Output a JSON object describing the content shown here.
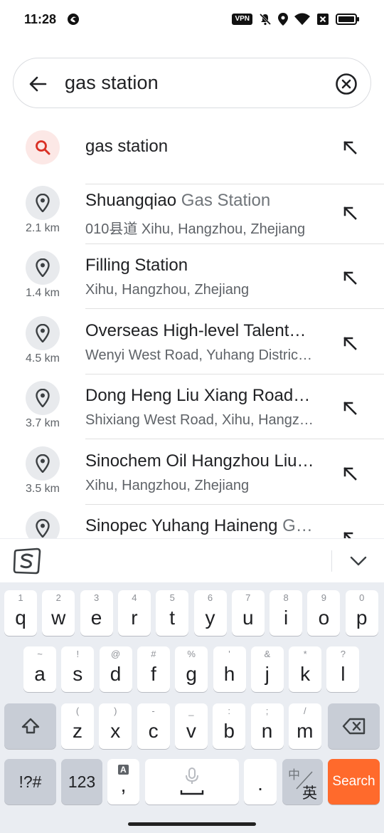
{
  "status_bar": {
    "time": "11:28",
    "vpn_label": "VPN",
    "icons": [
      "vpn-icon",
      "mute-icon",
      "location-icon",
      "wifi-icon",
      "no-sim-icon",
      "battery-icon"
    ]
  },
  "search": {
    "query": "gas station",
    "back_icon": "arrow-left-icon",
    "clear_icon": "clear-circle-icon"
  },
  "results": [
    {
      "type": "query",
      "title": "gas station",
      "title_muted": "",
      "subtitle": "",
      "distance": ""
    },
    {
      "type": "place",
      "title": "Shuangqiao ",
      "title_muted": "Gas Station",
      "subtitle": "010县道 Xihu, Hangzhou, Zhejiang",
      "distance": "2.1 km"
    },
    {
      "type": "place",
      "title": "Filling Station",
      "title_muted": "",
      "subtitle": "Xihu, Hangzhou, Zhejiang",
      "distance": "1.4 km"
    },
    {
      "type": "place",
      "title": "Overseas High-level Talent…",
      "title_muted": "",
      "subtitle": "Wenyi West Road, Yuhang Distric…",
      "distance": "4.5 km"
    },
    {
      "type": "place",
      "title": "Dong Heng Liu Xiang Road…",
      "title_muted": "",
      "subtitle": "Shixiang West Road, Xihu, Hangz…",
      "distance": "3.7 km"
    },
    {
      "type": "place",
      "title": "Sinochem Oil Hangzhou Liu…",
      "title_muted": "",
      "subtitle": "Xihu, Hangzhou, Zhejiang",
      "distance": "3.5 km"
    },
    {
      "type": "place",
      "title": "Sinopec Yuhang Haineng ",
      "title_muted": "G…",
      "subtitle": "",
      "distance": ""
    }
  ],
  "keyboard": {
    "row1": [
      {
        "hint": "1",
        "key": "q"
      },
      {
        "hint": "2",
        "key": "w"
      },
      {
        "hint": "3",
        "key": "e"
      },
      {
        "hint": "4",
        "key": "r"
      },
      {
        "hint": "5",
        "key": "t"
      },
      {
        "hint": "6",
        "key": "y"
      },
      {
        "hint": "7",
        "key": "u"
      },
      {
        "hint": "8",
        "key": "i"
      },
      {
        "hint": "9",
        "key": "o"
      },
      {
        "hint": "0",
        "key": "p"
      }
    ],
    "row2": [
      {
        "hint": "~",
        "key": "a"
      },
      {
        "hint": "!",
        "key": "s"
      },
      {
        "hint": "@",
        "key": "d"
      },
      {
        "hint": "#",
        "key": "f"
      },
      {
        "hint": "%",
        "key": "g"
      },
      {
        "hint": "'",
        "key": "h"
      },
      {
        "hint": "&",
        "key": "j"
      },
      {
        "hint": "*",
        "key": "k"
      },
      {
        "hint": "?",
        "key": "l"
      }
    ],
    "row3": [
      {
        "hint": "(",
        "key": "z"
      },
      {
        "hint": ")",
        "key": "x"
      },
      {
        "hint": "-",
        "key": "c"
      },
      {
        "hint": "_",
        "key": "v"
      },
      {
        "hint": ":",
        "key": "b"
      },
      {
        "hint": ";",
        "key": "n"
      },
      {
        "hint": "/",
        "key": "m"
      }
    ],
    "symbols_label": "!?#",
    "numbers_label": "123",
    "comma_label": ",",
    "comma_hint": "A",
    "period_label": ".",
    "lang_top": "中",
    "lang_bottom": "英",
    "search_label": "Search"
  },
  "colors": {
    "accent": "#ff6a2c",
    "query_icon": "#d93025",
    "icon_bg": "#e8eaed",
    "keyboard_bg": "#eaedf2"
  }
}
